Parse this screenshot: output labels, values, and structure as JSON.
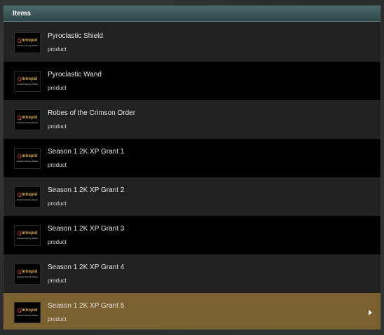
{
  "header": {
    "title": "Items"
  },
  "logo": {
    "word": "Intrepid",
    "tagline": "Intrepid Gaming Studio",
    "colors": {
      "mark": "#c9362a",
      "word": "#e3b24a"
    }
  },
  "items": [
    {
      "title": "Pyroclastic Shield",
      "subtitle": "product"
    },
    {
      "title": "Pyroclastic Wand",
      "subtitle": "product"
    },
    {
      "title": "Robes of the Crimson Order",
      "subtitle": "product"
    },
    {
      "title": "Season 1 2K XP Grant 1",
      "subtitle": "product"
    },
    {
      "title": "Season 1 2K XP Grant 2",
      "subtitle": "product"
    },
    {
      "title": "Season 1 2K XP Grant 3",
      "subtitle": "product"
    },
    {
      "title": "Season 1 2K XP Grant 4",
      "subtitle": "product"
    },
    {
      "title": "Season 1 2K XP Grant 5",
      "subtitle": "product",
      "selected": true,
      "icon": "chevron-right-icon"
    }
  ],
  "colors": {
    "header": "#3f5c5a",
    "row_dark": "#222222",
    "row_black": "#000000",
    "selected": "#7b6030"
  }
}
